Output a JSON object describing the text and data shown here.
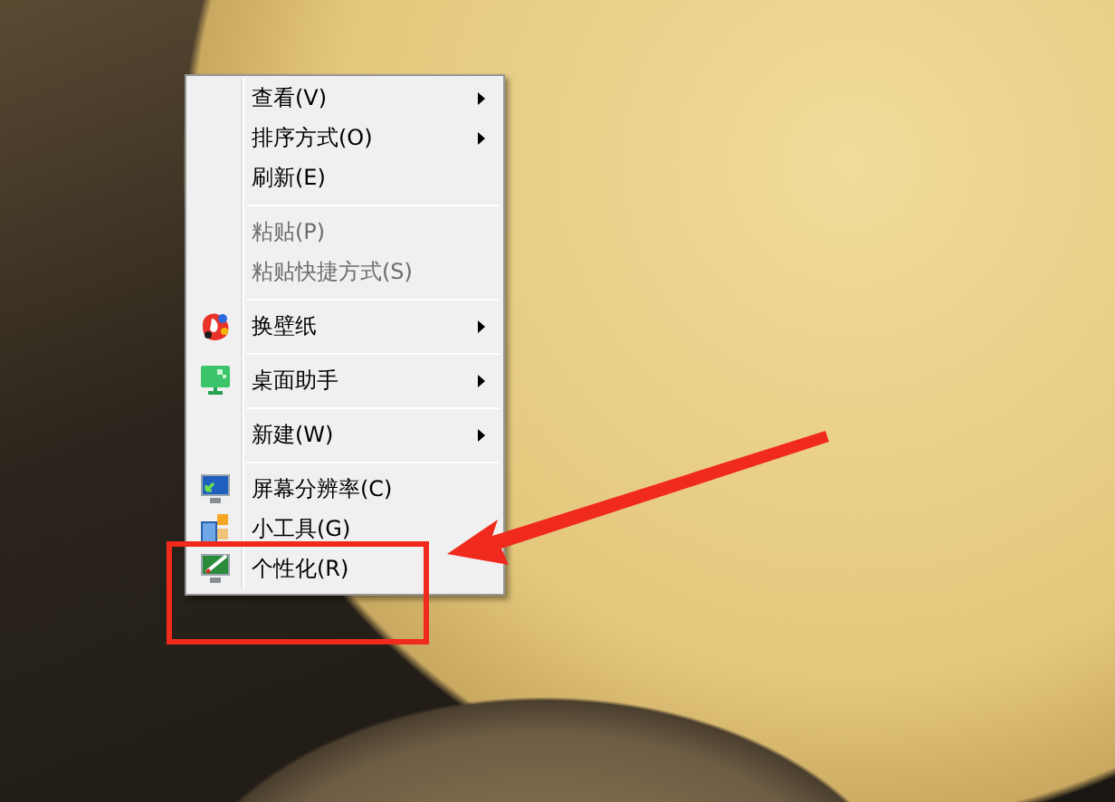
{
  "context_menu": {
    "groups": [
      [
        {
          "label": "查看(V)",
          "submenu": true,
          "disabled": false,
          "kind": "plain"
        },
        {
          "label": "排序方式(O)",
          "submenu": true,
          "disabled": false,
          "kind": "plain"
        },
        {
          "label": "刷新(E)",
          "submenu": false,
          "disabled": false,
          "kind": "plain"
        }
      ],
      [
        {
          "label": "粘贴(P)",
          "submenu": false,
          "disabled": true,
          "kind": "plain"
        },
        {
          "label": "粘贴快捷方式(S)",
          "submenu": false,
          "disabled": true,
          "kind": "plain"
        }
      ],
      [
        {
          "label": "换壁纸",
          "submenu": true,
          "disabled": false,
          "kind": "icon"
        }
      ],
      [
        {
          "label": "桌面助手",
          "submenu": true,
          "disabled": false,
          "kind": "icon"
        }
      ],
      [
        {
          "label": "新建(W)",
          "submenu": true,
          "disabled": false,
          "kind": "plain"
        }
      ],
      [
        {
          "label": "屏幕分辨率(C)",
          "submenu": false,
          "disabled": false,
          "kind": "icon"
        },
        {
          "label": "小工具(G)",
          "submenu": false,
          "disabled": false,
          "kind": "icon"
        },
        {
          "label": "个性化(R)",
          "submenu": false,
          "disabled": false,
          "kind": "icon"
        }
      ]
    ]
  }
}
